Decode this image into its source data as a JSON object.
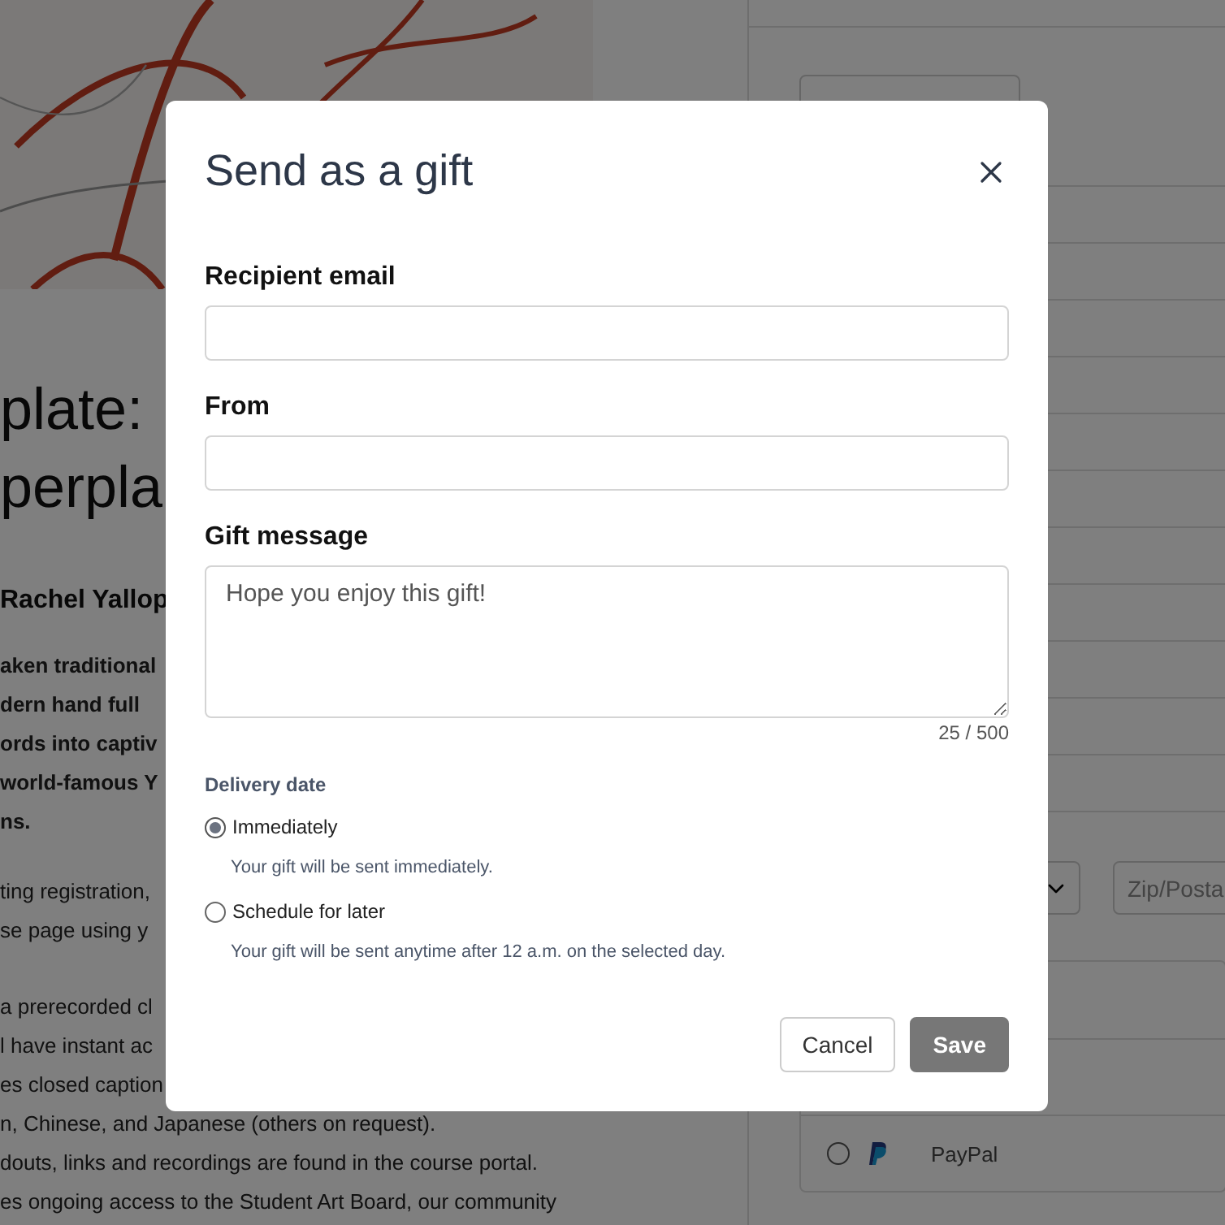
{
  "course": {
    "title_lines": [
      "plate:",
      "perpla"
    ],
    "author": "Rachel Yallop",
    "summary_lines": [
      "aken traditional",
      "dern hand full",
      "ords into captiv",
      "world-famous Y",
      "ns."
    ],
    "detail_paragraphs": [
      [
        "ting registration,",
        "se page using y"
      ],
      [
        "a prerecorded cl",
        "l have instant ac",
        "es closed caption",
        "n, Chinese, and Japanese (others on request).",
        "douts, links and recordings are found in the course portal.",
        "es ongoing access to the Student Art Board, our community"
      ]
    ]
  },
  "sidebar": {
    "zip_placeholder": "Zip/Posta",
    "payment_options": [
      {
        "label": "PayPal",
        "selected": false
      }
    ]
  },
  "dialog": {
    "title": "Send as a gift",
    "fields": [
      {
        "kind": "input",
        "label": "Recipient email"
      },
      {
        "kind": "input",
        "label": "From"
      },
      {
        "kind": "textarea",
        "label": "Gift message",
        "value": "Hope you enjoy this gift!"
      }
    ],
    "counter": "25 / 500",
    "delivery": {
      "label": "Delivery date",
      "options": [
        {
          "label": "Immediately",
          "hint": "Your gift will be sent immediately.",
          "selected": true
        },
        {
          "label": "Schedule for later",
          "hint": "Your gift will be sent anytime after 12 a.m. on the selected day.",
          "selected": false
        }
      ]
    },
    "buttons": [
      {
        "kind": "secondary",
        "label": "Cancel"
      },
      {
        "kind": "primary",
        "label": "Save"
      }
    ]
  }
}
